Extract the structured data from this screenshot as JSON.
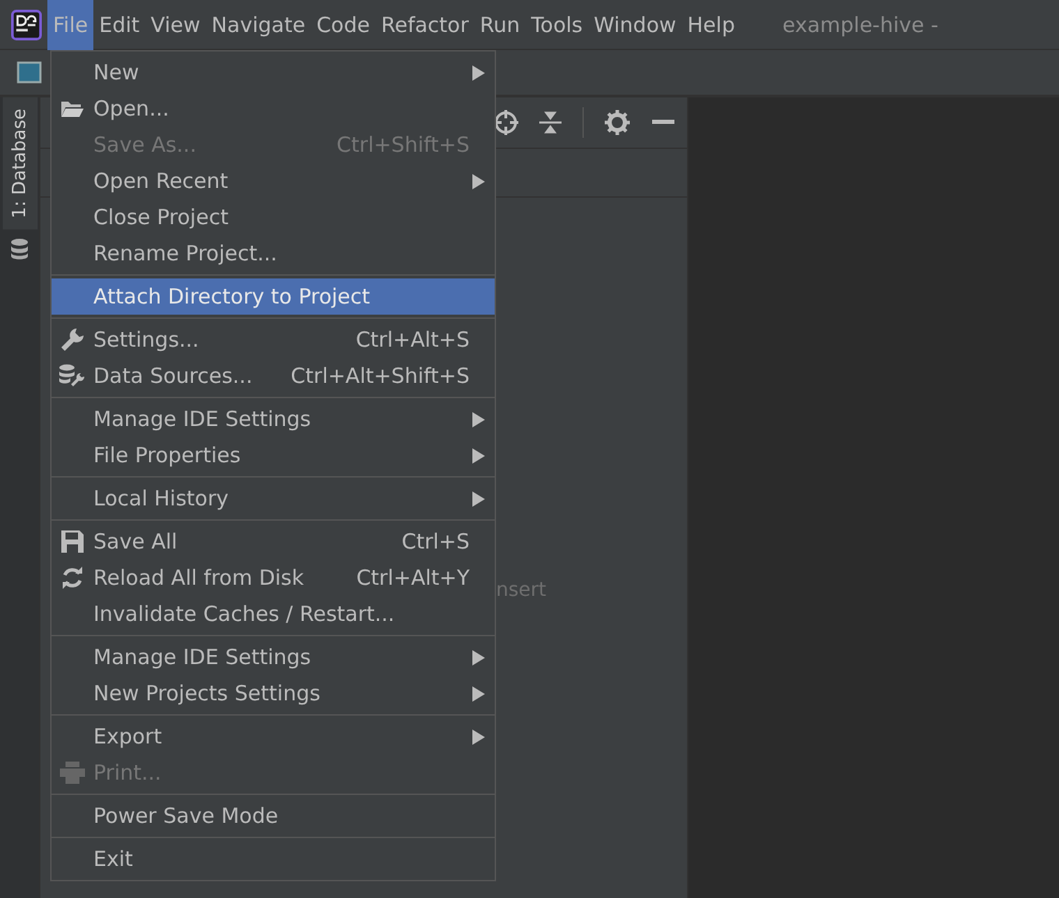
{
  "menubar": {
    "menus": [
      {
        "label": "File",
        "selected": true
      },
      {
        "label": "Edit",
        "selected": false
      },
      {
        "label": "View",
        "selected": false
      },
      {
        "label": "Navigate",
        "selected": false
      },
      {
        "label": "Code",
        "selected": false
      },
      {
        "label": "Refactor",
        "selected": false
      },
      {
        "label": "Run",
        "selected": false
      },
      {
        "label": "Tools",
        "selected": false
      },
      {
        "label": "Window",
        "selected": false
      },
      {
        "label": "Help",
        "selected": false
      }
    ],
    "title": "example-hive -"
  },
  "tool_strip": {
    "label": "1: Database"
  },
  "panel": {
    "hint": "nsert"
  },
  "file_menu": {
    "groups": [
      {
        "items": [
          {
            "label": "New",
            "submenu": true,
            "disabled": false,
            "selected": false
          },
          {
            "label": "Open...",
            "submenu": false,
            "disabled": false,
            "selected": false
          },
          {
            "label": "Save As...",
            "shortcut": "Ctrl+Shift+S",
            "submenu": false,
            "disabled": true,
            "selected": false
          },
          {
            "label": "Open Recent",
            "submenu": true,
            "disabled": false,
            "selected": false
          },
          {
            "label": "Close Project",
            "submenu": false,
            "disabled": false,
            "selected": false
          },
          {
            "label": "Rename Project...",
            "submenu": false,
            "disabled": false,
            "selected": false
          }
        ]
      },
      {
        "items": [
          {
            "label": "Attach Directory to Project",
            "submenu": false,
            "disabled": false,
            "selected": true
          }
        ]
      },
      {
        "items": [
          {
            "label": "Settings...",
            "shortcut": "Ctrl+Alt+S",
            "submenu": false,
            "disabled": false,
            "selected": false
          },
          {
            "label": "Data Sources...",
            "shortcut": "Ctrl+Alt+Shift+S",
            "submenu": false,
            "disabled": false,
            "selected": false
          }
        ]
      },
      {
        "items": [
          {
            "label": "Manage IDE Settings",
            "submenu": true,
            "disabled": false,
            "selected": false
          },
          {
            "label": "File Properties",
            "submenu": true,
            "disabled": false,
            "selected": false
          }
        ]
      },
      {
        "items": [
          {
            "label": "Local History",
            "submenu": true,
            "disabled": false,
            "selected": false
          }
        ]
      },
      {
        "items": [
          {
            "label": "Save All",
            "shortcut": "Ctrl+S",
            "submenu": false,
            "disabled": false,
            "selected": false
          },
          {
            "label": "Reload All from Disk",
            "shortcut": "Ctrl+Alt+Y",
            "submenu": false,
            "disabled": false,
            "selected": false
          },
          {
            "label": "Invalidate Caches / Restart...",
            "submenu": false,
            "disabled": false,
            "selected": false
          }
        ]
      },
      {
        "items": [
          {
            "label": "Manage IDE Settings",
            "submenu": true,
            "disabled": false,
            "selected": false
          },
          {
            "label": "New Projects Settings",
            "submenu": true,
            "disabled": false,
            "selected": false
          }
        ]
      },
      {
        "items": [
          {
            "label": "Export",
            "submenu": true,
            "disabled": false,
            "selected": false
          },
          {
            "label": "Print...",
            "submenu": false,
            "disabled": true,
            "selected": false
          }
        ]
      },
      {
        "items": [
          {
            "label": "Power Save Mode",
            "submenu": false,
            "disabled": false,
            "selected": false
          }
        ]
      },
      {
        "items": [
          {
            "label": "Exit",
            "submenu": false,
            "disabled": false,
            "selected": false
          }
        ]
      }
    ]
  }
}
